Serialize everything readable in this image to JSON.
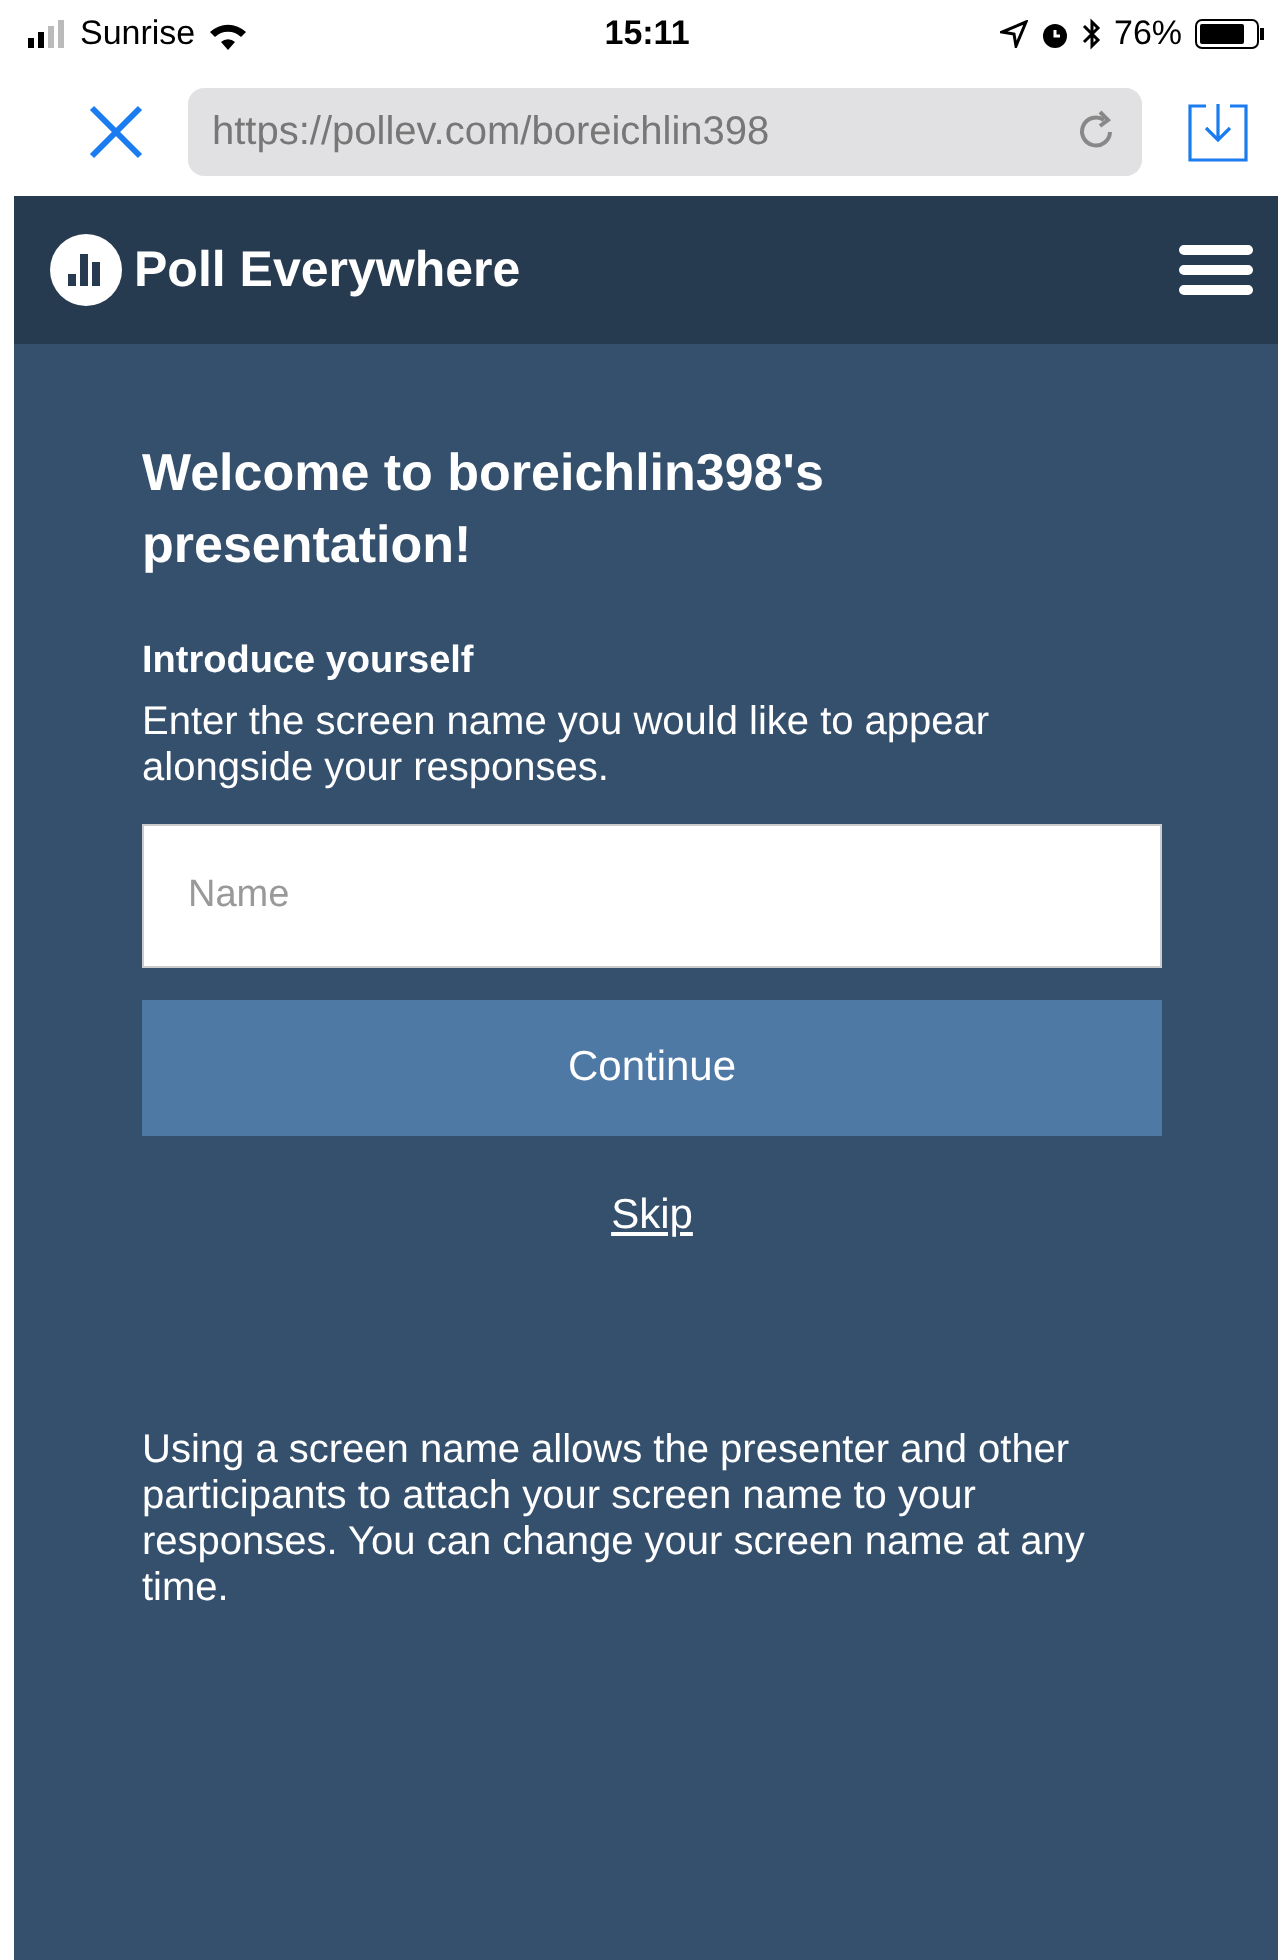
{
  "status_bar": {
    "carrier": "Sunrise",
    "time": "15:11",
    "battery": "76%"
  },
  "browser": {
    "url": "https://pollev.com/boreichlin398"
  },
  "header": {
    "brand": "Poll Everywhere"
  },
  "content": {
    "title": "Welcome to boreichlin398's presentation!",
    "subtitle": "Introduce yourself",
    "instructions": "Enter the screen name you would like to appear alongside your responses.",
    "name_field": {
      "placeholder": "Name"
    },
    "continue_button": "Continue",
    "skip_link": "Skip",
    "note": "Using a screen name allows the presenter and other participants to attach your screen name to your responses. You can change your screen name at any time."
  }
}
